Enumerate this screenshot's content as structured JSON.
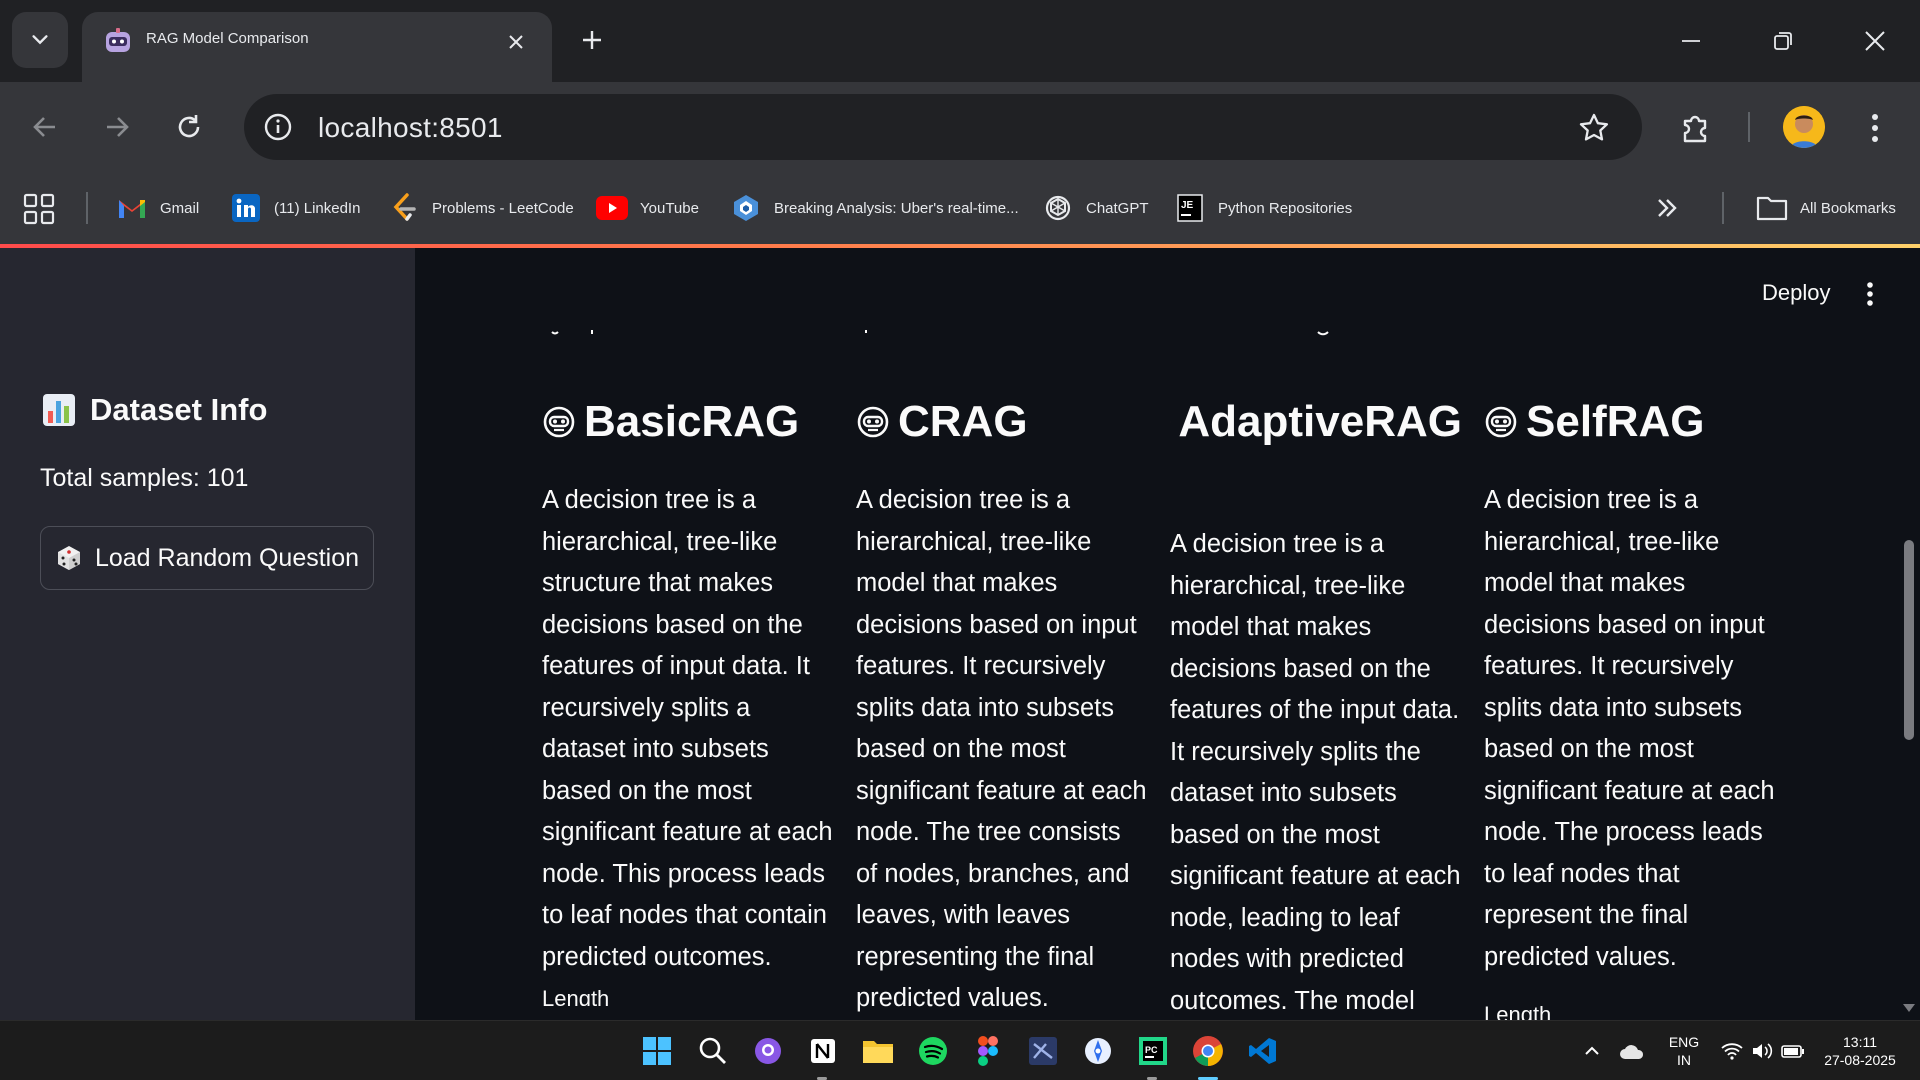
{
  "browser": {
    "tab_title": "RAG Model Comparison",
    "url": "localhost:8501",
    "bookmarks": [
      {
        "label": "Gmail",
        "icon": "gmail-icon"
      },
      {
        "label": "(11) LinkedIn",
        "icon": "linkedin-icon"
      },
      {
        "label": "Problems - LeetCode",
        "icon": "leetcode-icon"
      },
      {
        "label": "YouTube",
        "icon": "youtube-icon"
      },
      {
        "label": "Breaking Analysis: Uber's real-time...",
        "icon": "siliconangle-icon"
      },
      {
        "label": "ChatGPT",
        "icon": "chatgpt-icon"
      },
      {
        "label": "Python Repositories",
        "icon": "jetbrains-icon"
      }
    ],
    "all_bookmarks": "All Bookmarks"
  },
  "app": {
    "deploy": "Deploy",
    "sidebar": {
      "title": "Dataset Info",
      "total_samples": "Total samples: 101",
      "load_button": "Load Random Question"
    },
    "columns": [
      {
        "name": "BasicRAG",
        "answer": "A decision tree is a hierarchical, tree-like structure that makes decisions based on the features of input data. It recursively splits a dataset into subsets based on the most significant feature at each node. This process leads to leaf nodes that contain predicted outcomes.",
        "length_label": "Length"
      },
      {
        "name": "CRAG",
        "answer": "A decision tree is a hierarchical, tree-like model that makes decisions based on input features. It recursively splits data into subsets based on the most significant feature at each node. The tree consists of nodes, branches, and leaves, with leaves representing the final predicted values.",
        "length_label": ""
      },
      {
        "name": "AdaptiveRAG",
        "answer": "A decision tree is a hierarchical, tree-like model that makes decisions based on the features of the input data. It recursively splits the dataset into subsets based on the most significant feature at each node, leading to leaf nodes with predicted outcomes. The model consists of nodes",
        "length_label": ""
      },
      {
        "name": "SelfRAG",
        "answer": "A decision tree is a hierarchical, tree-like model that makes decisions based on input features. It recursively splits data into subsets based on the most significant feature at each node. The process leads to leaf nodes that represent the final predicted values.",
        "length_label": "Length"
      }
    ]
  },
  "taskbar": {
    "language": "ENG",
    "region": "IN",
    "time": "13:11",
    "date": "27-08-2025"
  },
  "colors": {
    "app_bg": "#0e1117",
    "sidebar_bg": "#262730",
    "chrome_dark": "#202124",
    "chrome_toolbar": "#35363a",
    "accent": "#ff4b4b"
  }
}
